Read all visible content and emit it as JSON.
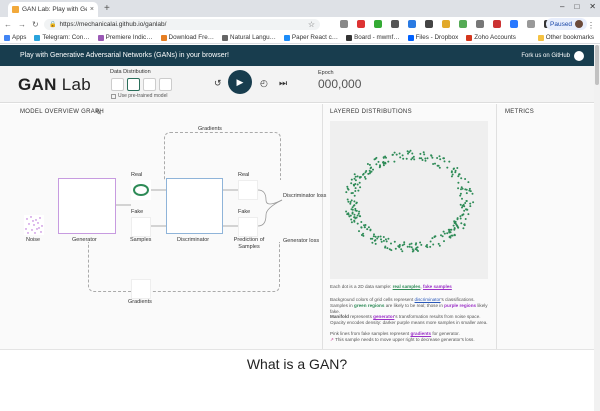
{
  "browser": {
    "tab_title": "GAN Lab: Play with Gene…",
    "url": "https://mechanicalai.github.io/ganlab/",
    "paused_label": "Paused",
    "new_tab": "+",
    "close": "×"
  },
  "bookmarks": [
    {
      "label": "Apps",
      "color": "#4285f4"
    },
    {
      "label": "Telegram: Con…",
      "color": "#2aa3dc"
    },
    {
      "label": "Premiere Indic…",
      "color": "#9b59b6"
    },
    {
      "label": "Download Fre…",
      "color": "#e67e22"
    },
    {
      "label": "Natural Langu…",
      "color": "#666666"
    },
    {
      "label": "Paper React c…",
      "color": "#1d8cf8"
    },
    {
      "label": "Board - mwmf…",
      "color": "#333333"
    },
    {
      "label": "Files - Dropbox",
      "color": "#0061ff"
    },
    {
      "label": "Zoho Accounts",
      "color": "#d4351c"
    }
  ],
  "other_bookmarks": "Other bookmarks",
  "banner": {
    "text": "Play with Generative Adversarial Networks (GANs) in your browser!",
    "fork": "Fork us on GitHub"
  },
  "header": {
    "logo_bold": "GAN",
    "logo_rest": " Lab",
    "data_distribution": "Data Distribution",
    "pretrained": "Use pre-trained model",
    "epoch_label": "Epoch",
    "epoch_value": "000,000"
  },
  "panels": {
    "model": "MODEL OVERVIEW GRAPH",
    "layered": "LAYERED DISTRIBUTIONS",
    "metrics": "METRICS"
  },
  "graph": {
    "gradients_top": "Gradients",
    "gradients_bottom": "Gradients",
    "noise": "Noise",
    "generator": "Generator",
    "real": "Real",
    "fake": "Fake",
    "samples": "Samples",
    "discriminator": "Discriminator",
    "real_out": "Real",
    "fake_out": "Fake",
    "prediction": "Prediction of Samples",
    "disc_loss": "Discriminator loss",
    "gen_loss": "Generator loss"
  },
  "captions": {
    "c1a": "Each dot is a 2D data sample:",
    "c1b": "real samples",
    "c1c": "fake samples",
    "c2a": "Background colors of grid cells represent",
    "c2b": "discriminator",
    "c2c": "'s classifications. Samples in",
    "c2d": "green regions",
    "c2e": "are likely to be real; those in",
    "c2f": "purple regions",
    "c2g": "likely fake.",
    "c3a": "Manifold",
    "c3b": "represents",
    "c3c": "generator",
    "c3d": "'s transformation results from noise space. Opacity encodes density: darker purple means more samples in smaller area.",
    "c4a": "Pink lines from fake samples represent",
    "c4b": "gradients",
    "c4c": "for generator.",
    "c4d": "This sample needs to move upper right to decrease generator's loss."
  },
  "section_title": "What is a GAN?",
  "colors": {
    "banner": "#183d4e",
    "real": "#2e8b57",
    "fake": "#9b30c7"
  }
}
